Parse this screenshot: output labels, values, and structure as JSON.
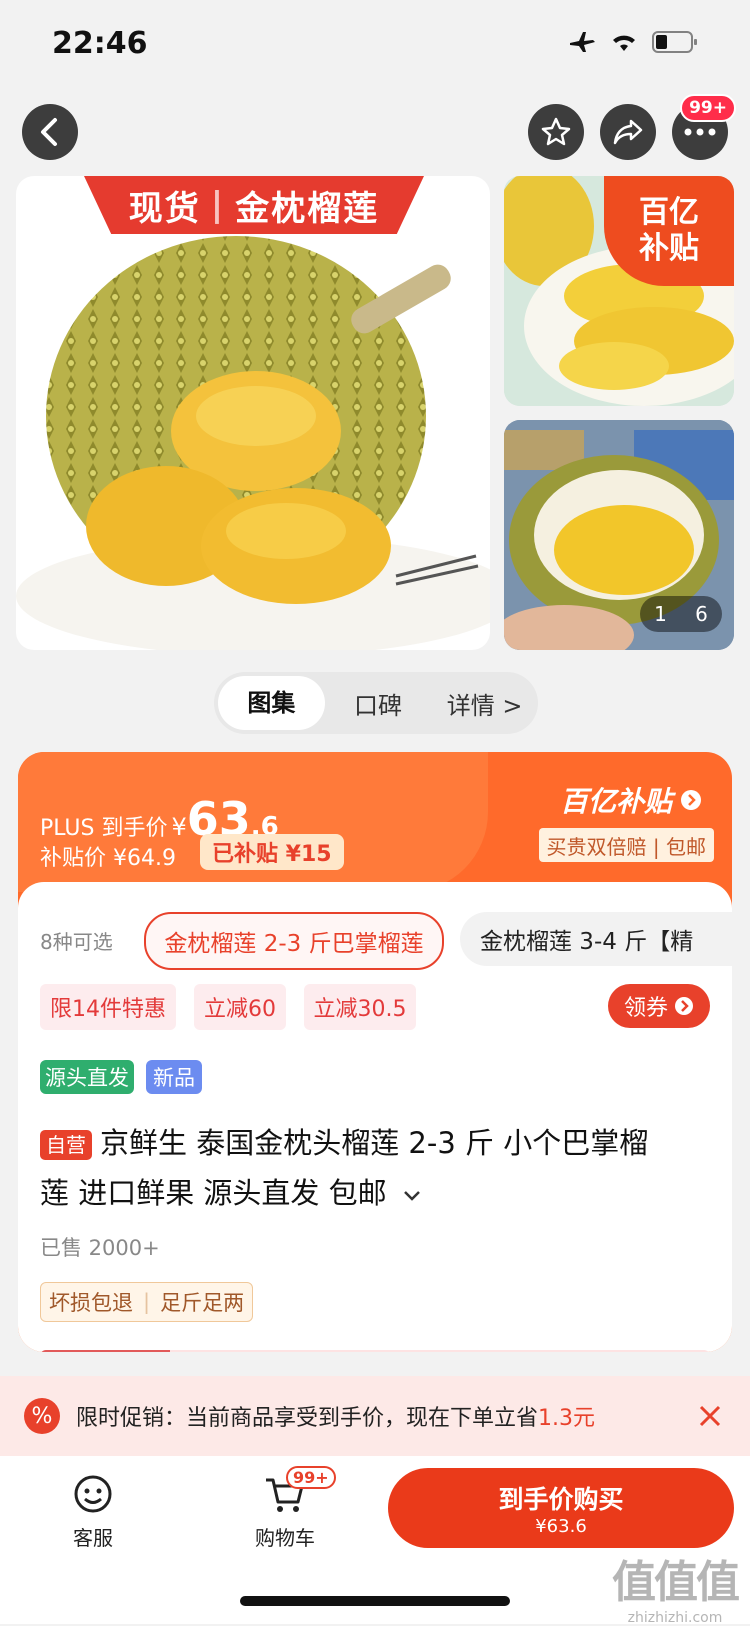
{
  "status_bar": {
    "time": "22:46"
  },
  "nav": {
    "more_badge": "99+"
  },
  "gallery": {
    "main_banner_left": "现货",
    "main_banner_right": "金枕榴莲",
    "subsidy_badge_line1": "百亿",
    "subsidy_badge_line2": "补贴",
    "page_current": "1",
    "page_total": "6",
    "tabs": [
      {
        "label": "图集"
      },
      {
        "label": "口碑"
      },
      {
        "label": "详情 >"
      }
    ]
  },
  "price": {
    "plus_label": "PLUS 到手价",
    "currency": "¥",
    "price_int": "63",
    "price_dec": ".6",
    "subsidy_price_label": "补贴价 ¥64.9",
    "subsidized_label": "已补贴 ¥15",
    "brand": "百亿补贴",
    "guarantee": "买贵双倍赔 | 包邮"
  },
  "options": {
    "count_label": "8种可选",
    "items": [
      {
        "label": "金枕榴莲 2-3 斤巴掌榴莲"
      },
      {
        "label": "金枕榴莲 3-4 斤【精"
      }
    ]
  },
  "promos": {
    "items": [
      {
        "label": "限14件特惠"
      },
      {
        "label": "立减60"
      },
      {
        "label": "立减30.5"
      }
    ],
    "coupon_label": "领券"
  },
  "tags": [
    {
      "label": "源头直发",
      "color": "#2fae6e"
    },
    {
      "label": "新品",
      "color": "#6c8cf0"
    }
  ],
  "product": {
    "self_badge": "自营",
    "title_line1": "京鲜生 泰国金枕头榴莲 2-3 斤 小个巴掌榴",
    "title_line2": "莲 进口鲜果 源头直发 包邮",
    "sold": "已售 2000+",
    "service_1": "坏损包退",
    "service_2": "足斤足两"
  },
  "promo_bar": {
    "text": "限时促销：当前商品享受到手价，现在下单立省",
    "amount": "1.3元"
  },
  "bottom": {
    "service_label": "客服",
    "cart_label": "购物车",
    "cart_badge": "99+",
    "buy_label": "到手价购买",
    "buy_price": "¥63.6"
  },
  "watermark": {
    "text": "值值值",
    "url": "zhizhizhi.com"
  },
  "colors": {
    "accent": "#ff5a1f",
    "brand_red": "#e8412b",
    "promo_bg": "#fde9e7"
  }
}
